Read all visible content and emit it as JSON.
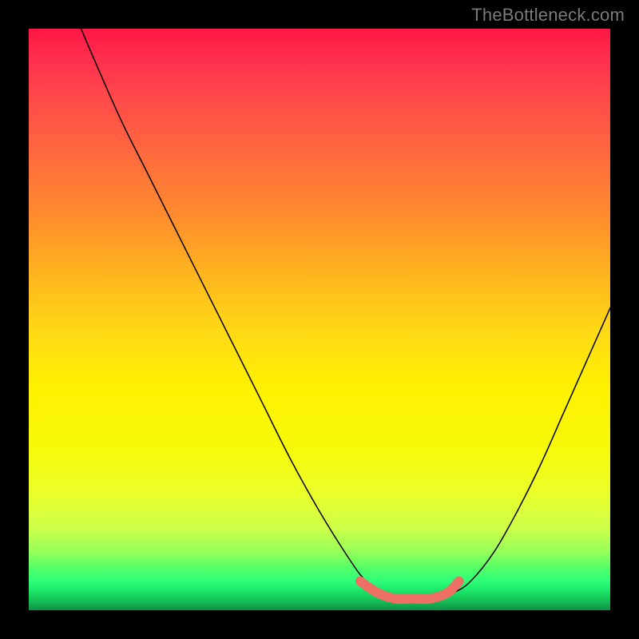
{
  "watermark": "TheBottleneck.com",
  "colors": {
    "curve": "#000000",
    "highlight": "#ec7063",
    "frame": "#000000"
  },
  "chart_data": {
    "type": "line",
    "title": "",
    "xlabel": "",
    "ylabel": "",
    "xlim": [
      0,
      100
    ],
    "ylim": [
      0,
      100
    ],
    "grid": false,
    "legend": false,
    "series": [
      {
        "name": "bottleneck-curve",
        "x": [
          9,
          12,
          16,
          20,
          25,
          30,
          35,
          40,
          45,
          50,
          55,
          58,
          61,
          64,
          67,
          70,
          73,
          76,
          80,
          84,
          88,
          92,
          96,
          100
        ],
        "y": [
          100,
          93,
          84,
          76,
          66,
          56,
          46,
          36,
          26,
          17,
          9,
          5,
          3,
          2,
          2,
          2,
          3,
          5,
          10,
          17,
          25,
          34,
          43,
          52
        ]
      },
      {
        "name": "valley-highlight",
        "x": [
          57,
          60,
          63,
          66,
          69,
          72,
          74
        ],
        "y": [
          5,
          3,
          2,
          2,
          2,
          3,
          5
        ]
      }
    ],
    "annotations": []
  }
}
